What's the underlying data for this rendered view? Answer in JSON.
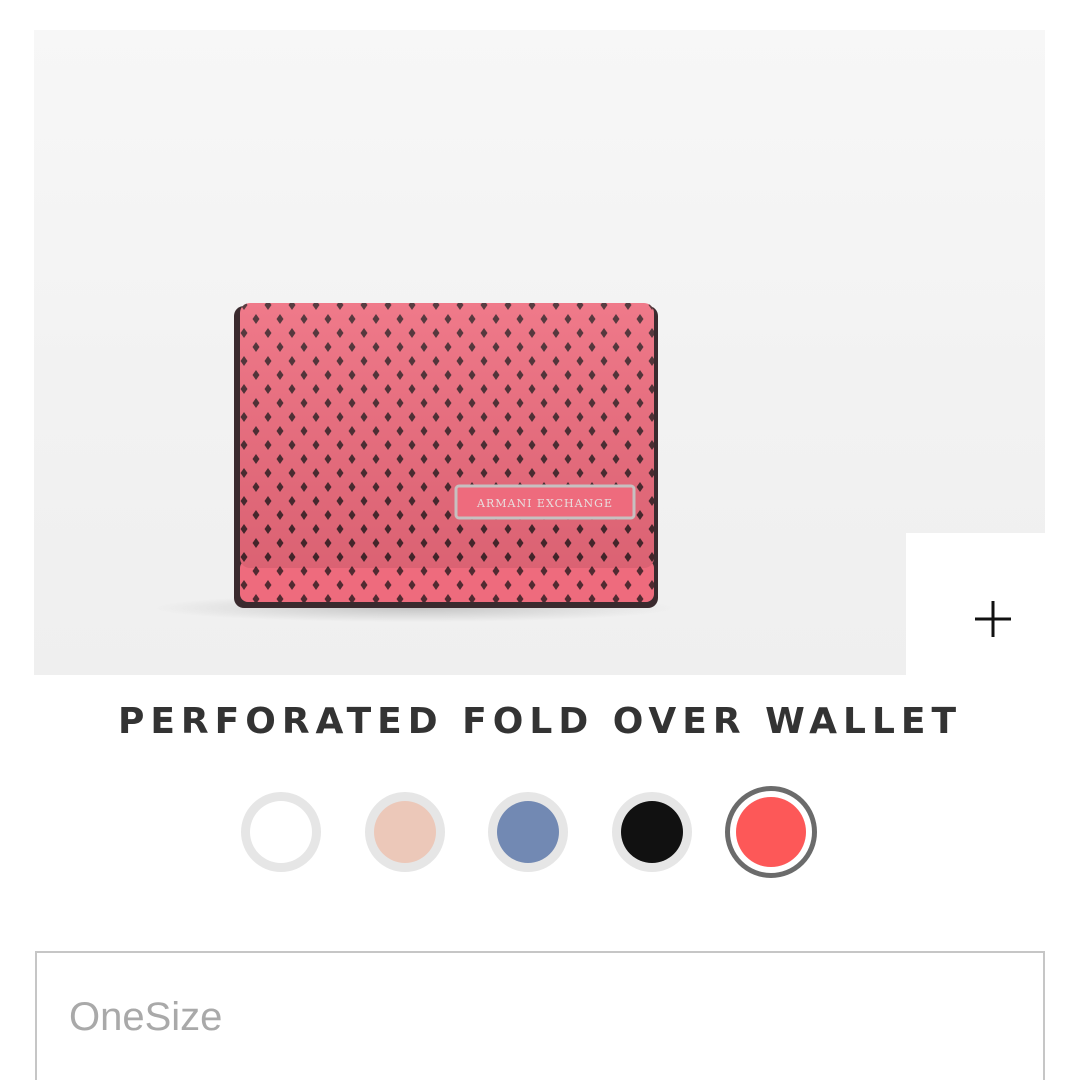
{
  "product": {
    "title": "PERFORATED FOLD OVER WALLET",
    "image_alt": "pink perforated fold over wallet",
    "wallet_color": "#ee6b7d",
    "logo_text": "ARMANI EXCHANGE"
  },
  "zoom": {
    "icon": "plus-icon"
  },
  "swatches": [
    {
      "name": "white",
      "color": "#ffffff",
      "selected": false
    },
    {
      "name": "blush",
      "color": "#ecc8b9",
      "selected": false
    },
    {
      "name": "blue",
      "color": "#7289b3",
      "selected": false
    },
    {
      "name": "black",
      "color": "#111111",
      "selected": false
    },
    {
      "name": "coral",
      "color": "#fd5858",
      "selected": true
    }
  ],
  "size_select": {
    "value": "OneSize"
  }
}
